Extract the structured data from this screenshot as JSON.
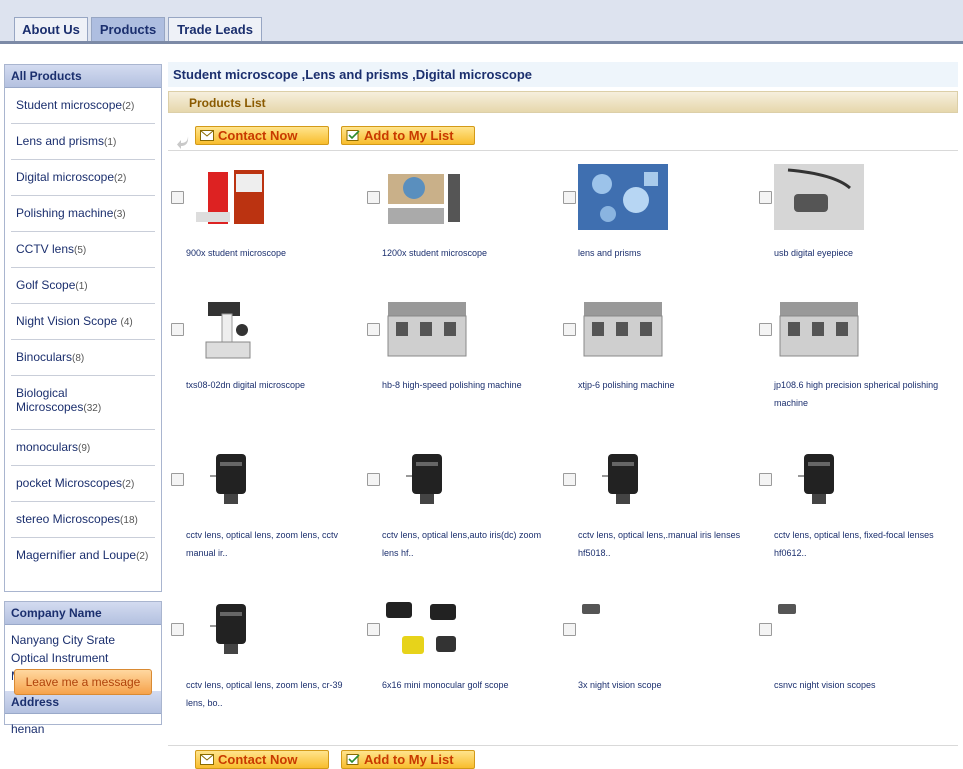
{
  "tabs": [
    {
      "label": "About Us",
      "active": false
    },
    {
      "label": "Products",
      "active": true
    },
    {
      "label": "Trade Leads",
      "active": false
    }
  ],
  "sidebar": {
    "header": "All Products",
    "categories": [
      {
        "name": "Student microscope",
        "count": "(2)"
      },
      {
        "name": "Lens and prisms",
        "count": "(1)"
      },
      {
        "name": "Digital microscope",
        "count": "(2)"
      },
      {
        "name": "Polishing machine",
        "count": "(3)"
      },
      {
        "name": "CCTV lens",
        "count": "(5)"
      },
      {
        "name": "Golf Scope",
        "count": "(1)"
      },
      {
        "name": "Night Vision Scope ",
        "count": "(4)"
      },
      {
        "name": "Binoculars",
        "count": "(8)"
      },
      {
        "name": "Biological Microscopes",
        "count": "(32)"
      },
      {
        "name": "monoculars",
        "count": "(9)"
      },
      {
        "name": "pocket Microscopes",
        "count": "(2)"
      },
      {
        "name": "stereo Microscopes",
        "count": "(18)"
      },
      {
        "name": "Magernifier and Loupe",
        "count": "(2)"
      }
    ],
    "company_header": "Company Name",
    "company_name": "Nanyang City Srate Optical Instrument Manufactory",
    "address_header": "Address",
    "address": "henan",
    "leave_message": "Leave me a message"
  },
  "main": {
    "title": "Student microscope ,Lens and prisms ,Digital microscope",
    "list_header": "Products List",
    "contact_now": "Contact Now",
    "add_to_list": "Add to My List"
  },
  "products": [
    {
      "name": "900x student microscope",
      "icon": "red-microscope-kit-photo"
    },
    {
      "name": "1200x student microscope",
      "icon": "microscope-kit-photo"
    },
    {
      "name": "lens and prisms",
      "icon": "lens-prisms-photo"
    },
    {
      "name": "usb digital eyepiece",
      "icon": "usb-eyepiece-photo"
    },
    {
      "name": "txs08-02dn digital microscope",
      "icon": "digital-microscope-photo"
    },
    {
      "name": "hb-8 high-speed polishing machine",
      "icon": "polishing-machine-photo"
    },
    {
      "name": "xtjp-6 polishing machine",
      "icon": "polishing-machine-photo"
    },
    {
      "name": "jp108.6 high precision spherical polishing machine",
      "icon": "polishing-machine-photo"
    },
    {
      "name": "cctv lens, optical lens, zoom lens, cctv manual ir..",
      "icon": "cctv-lens-photo"
    },
    {
      "name": "cctv lens, optical lens,auto iris(dc) zoom lens hf..",
      "icon": "cctv-lens-photo"
    },
    {
      "name": "cctv lens, optical lens,.manual iris lenses hf5018..",
      "icon": "cctv-lens-photo"
    },
    {
      "name": "cctv lens, optical lens, fixed-focal lenses hf0612..",
      "icon": "cctv-lens-photo"
    },
    {
      "name": "cctv lens, optical lens, zoom lens, cr-39 lens, bo..",
      "icon": "cctv-lens-photo"
    },
    {
      "name": "6x16 mini monocular golf scope",
      "icon": "golf-scope-photo"
    },
    {
      "name": "3x night vision scope",
      "icon": "night-vision-photo"
    },
    {
      "name": "csnvc night vision scopes",
      "icon": "night-vision-photo"
    }
  ],
  "colors": {
    "link": "#1b2f6e",
    "tab_active": "#aebee0",
    "button_orange": "#f8bd2d"
  }
}
